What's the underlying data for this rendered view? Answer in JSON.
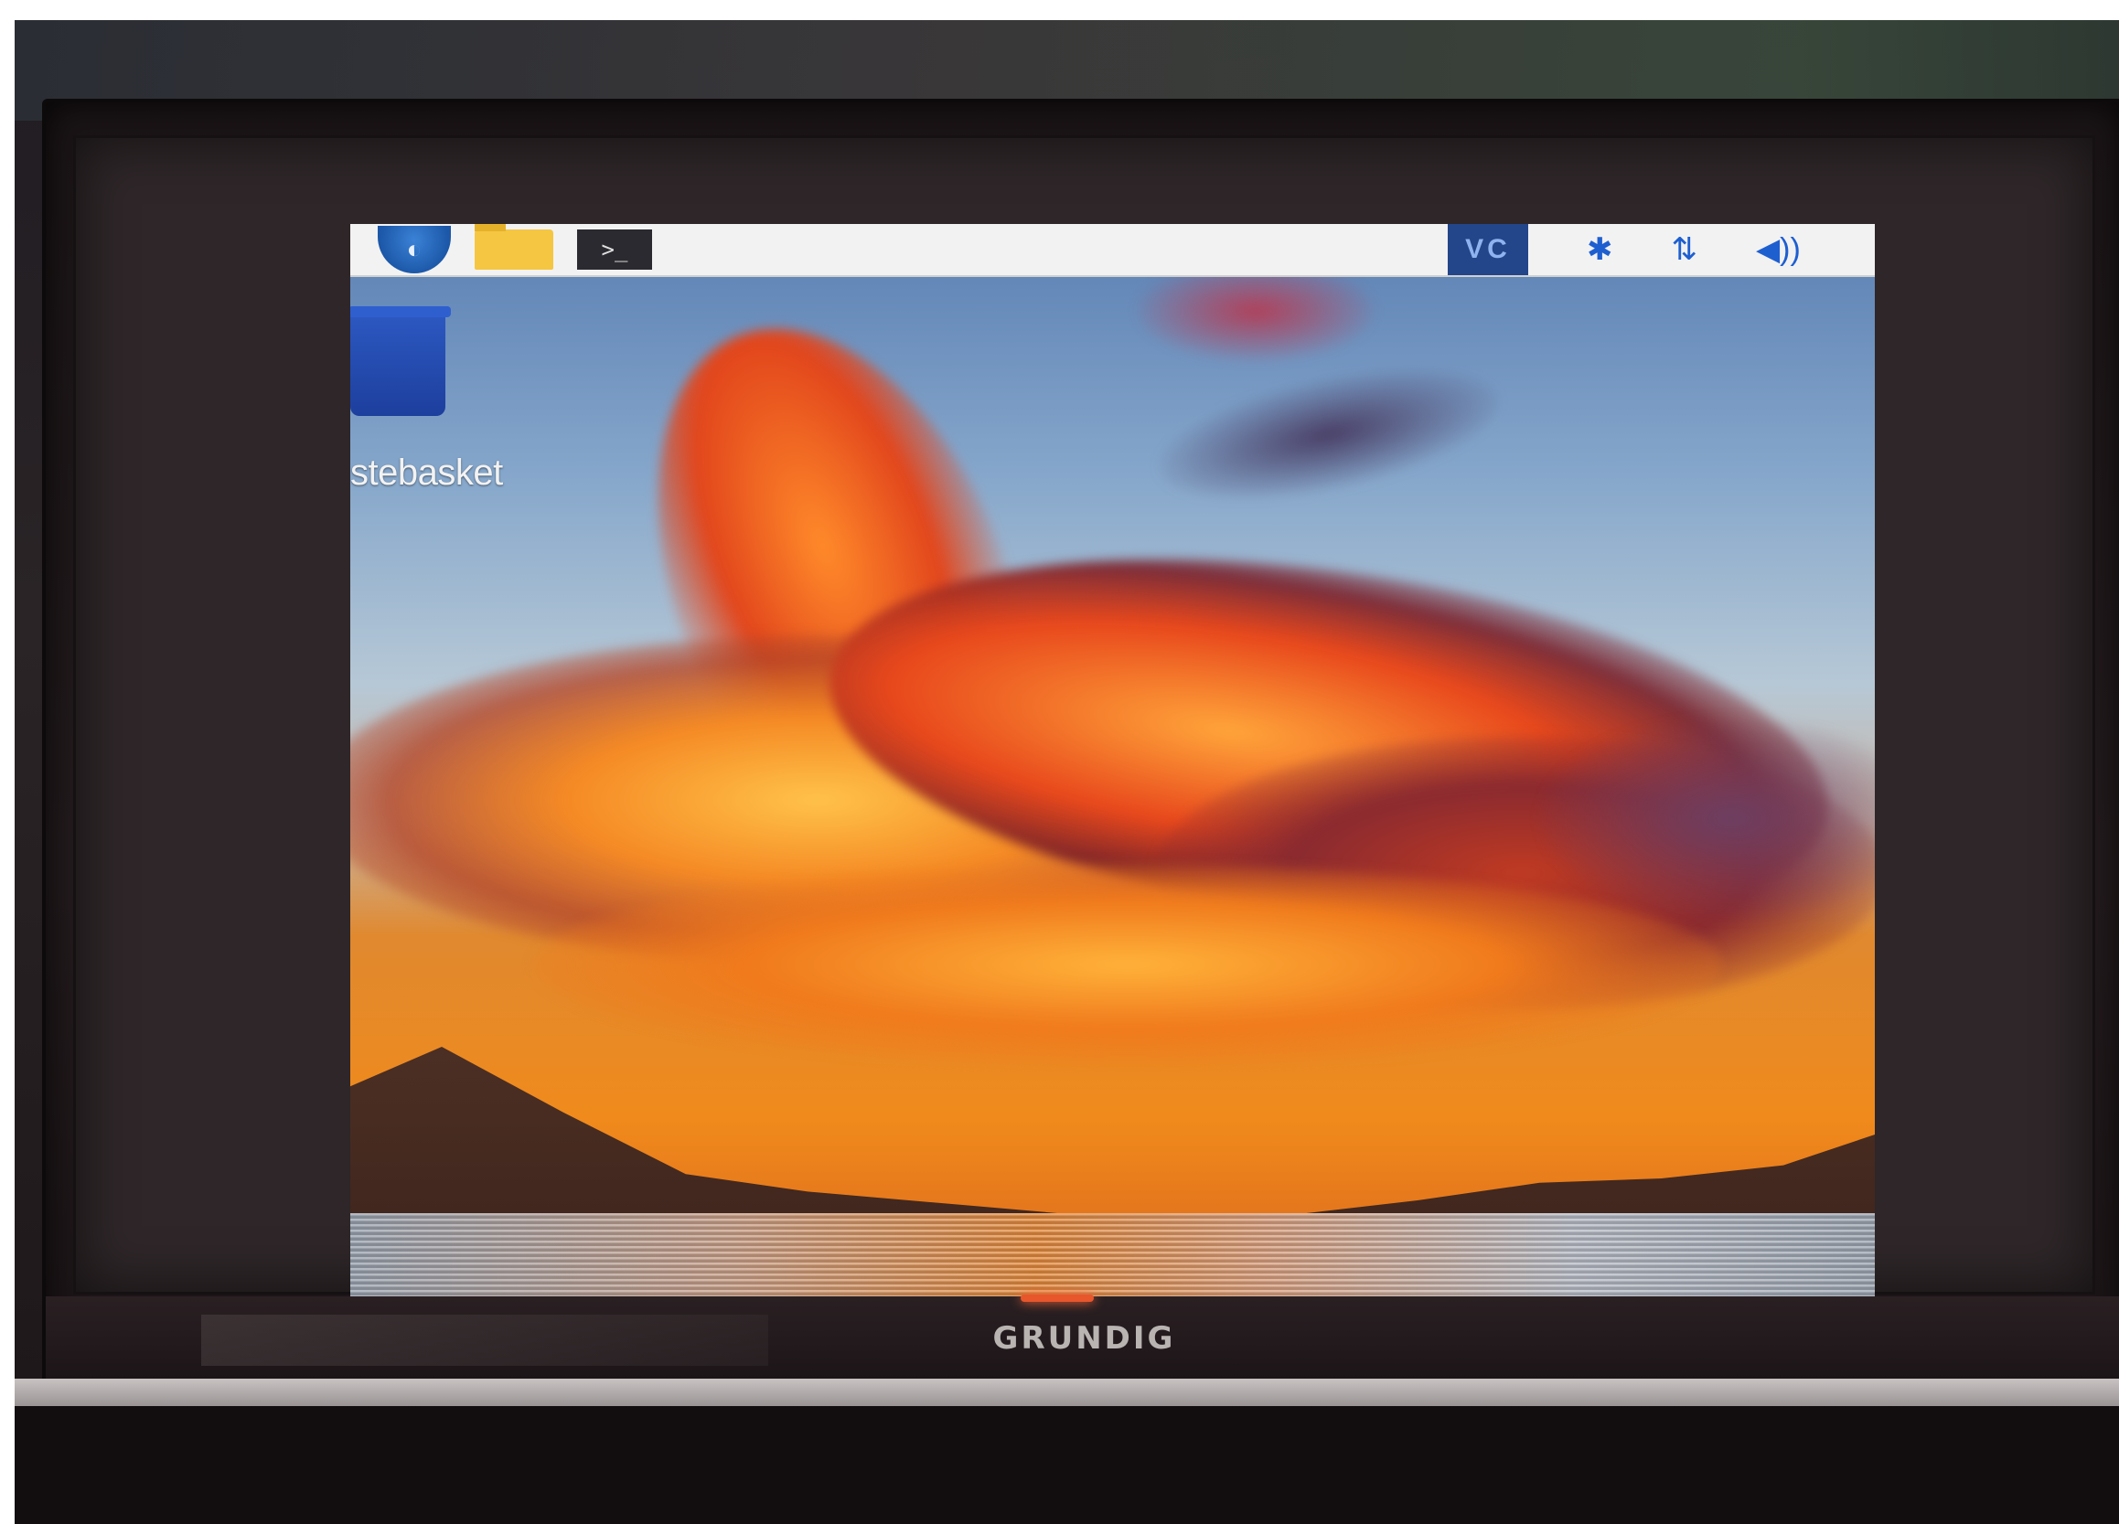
{
  "taskbar": {
    "menu_icon": "raspberry-menu-icon",
    "file_manager_icon": "folder-icon",
    "terminal_icon": "terminal-icon",
    "terminal_glyph": ">_",
    "vnc_label": "VC",
    "bluetooth_glyph": "✱",
    "network_glyph": "⇅",
    "volume_glyph": "◀))",
    "separator_glyph": "|"
  },
  "desktop": {
    "wastebasket_label": "stebasket",
    "wastebasket_icon": "trash-icon"
  },
  "tv": {
    "brand": "GRUNDIG",
    "led_color": "#e8562c"
  },
  "wallpaper": {
    "description_colors": [
      "#5a7fb3",
      "#f08a1c",
      "#d0561b"
    ]
  }
}
